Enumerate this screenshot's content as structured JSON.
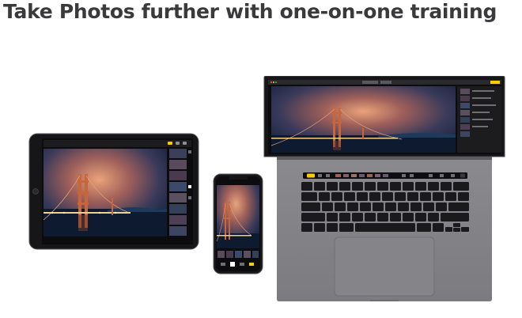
{
  "headline": "Take Photos further with one-on-one training",
  "devices": [
    {
      "name": "iPad",
      "shows": "Photos app editing view"
    },
    {
      "name": "iPhone",
      "shows": "Photos app editing view"
    },
    {
      "name": "MacBook Pro",
      "shows": "Photos app editing view with Touch Bar"
    }
  ],
  "colors": {
    "headline": "#3a3a3c",
    "device_frame": "#1d1d1f",
    "macbook_body": "#8e8e93",
    "photo_glow": "#e0976a",
    "photo_sky": "#1a2a4a"
  }
}
